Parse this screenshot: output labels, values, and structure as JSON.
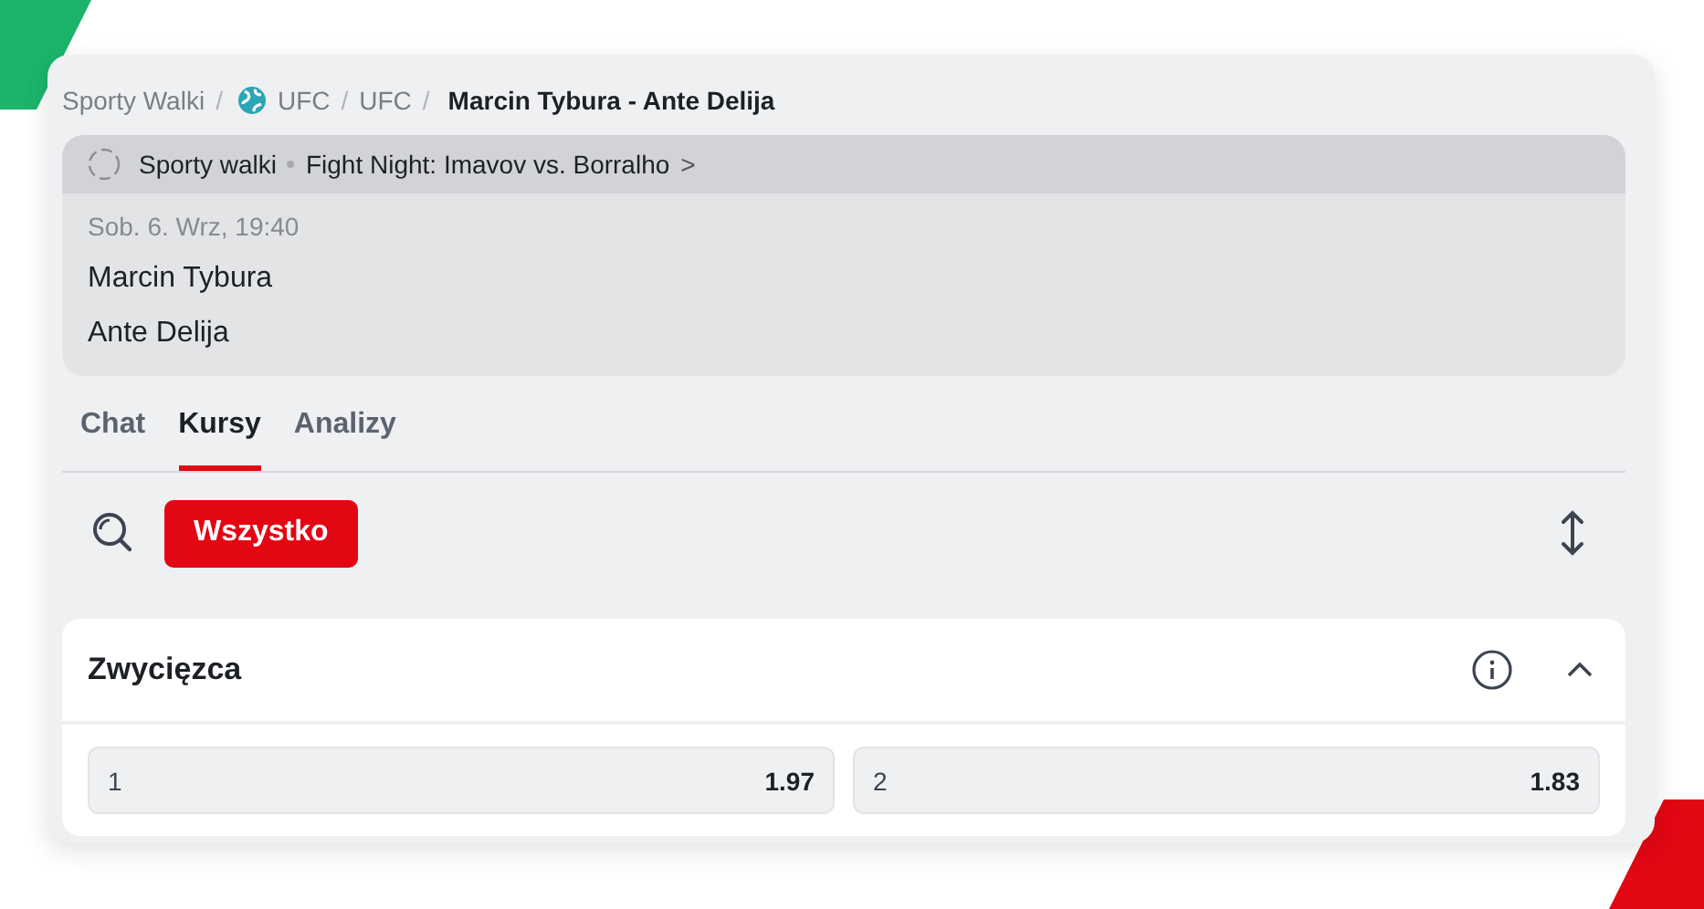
{
  "breadcrumb_separator": "/",
  "breadcrumbs": [
    {
      "label": "Sporty Walki",
      "kind": "text"
    },
    {
      "label": "UFC",
      "kind": "globe"
    },
    {
      "label": "UFC",
      "kind": "text"
    },
    {
      "label": "Marcin Tybura - Ante Delija",
      "kind": "current"
    }
  ],
  "event": {
    "sport": "Sporty walki",
    "league": "Fight Night: Imavov vs. Borralho",
    "chevron": ">",
    "date": "Sob. 6. Wrz, 19:40",
    "competitors": [
      "Marcin Tybura",
      "Ante Delija"
    ]
  },
  "tabs": [
    {
      "label": "Chat",
      "selected": false
    },
    {
      "label": "Kursy",
      "selected": true
    },
    {
      "label": "Analizy",
      "selected": false
    }
  ],
  "filters": [
    {
      "label": "Wszystko",
      "selected": true
    }
  ],
  "market": {
    "title": "Zwycięzca",
    "expanded": true,
    "odds": [
      {
        "label": "1",
        "value": "1.97"
      },
      {
        "label": "2",
        "value": "1.83"
      }
    ]
  }
}
